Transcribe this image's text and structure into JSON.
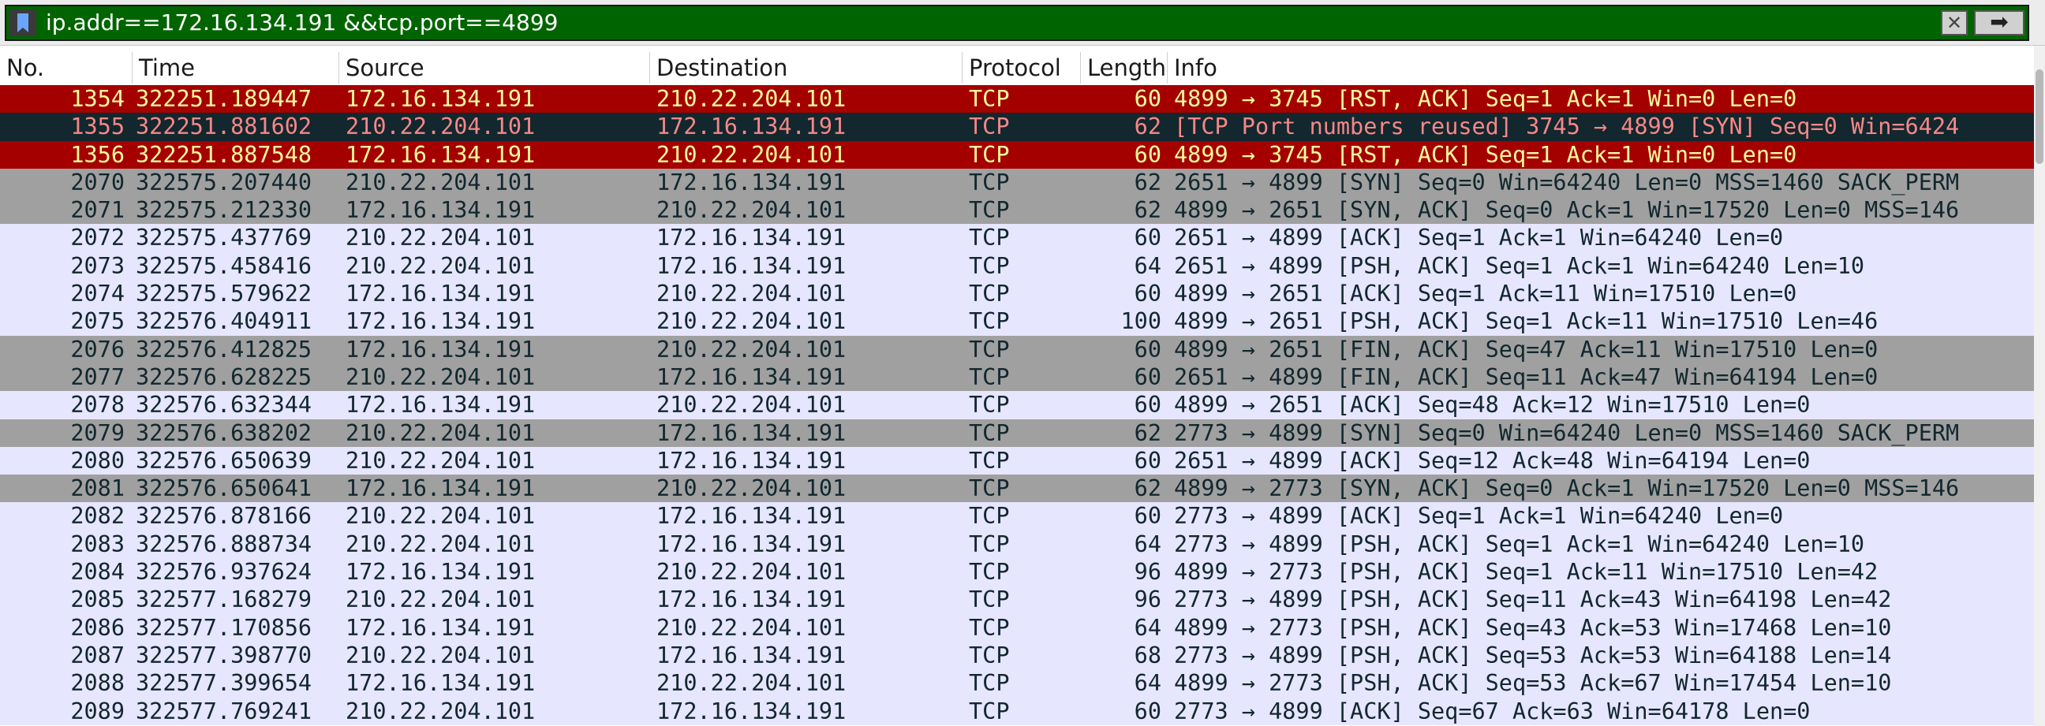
{
  "filter": {
    "value": "ip.addr==172.16.134.191 &&tcp.port==4899"
  },
  "toolbar": {
    "clear_glyph": "✕",
    "apply_glyph": "➡"
  },
  "columns": {
    "no": "No.",
    "time": "Time",
    "source": "Source",
    "destination": "Destination",
    "protocol": "Protocol",
    "length": "Length",
    "info": "Info"
  },
  "colors": {
    "rst_bg": "#a40000",
    "rst_fg": "#fffc9c",
    "reused_bg": "#12272e",
    "reused_fg": "#f78787",
    "syn_fin_bg": "#a0a0a0",
    "syn_fin_fg": "#12272e",
    "tcp_bg": "#e7e6ff",
    "tcp_fg": "#12272e",
    "filter_bg": "#006400"
  },
  "packets": [
    {
      "no": "1354",
      "time": "322251.189447",
      "source": "172.16.134.191",
      "destination": "210.22.204.101",
      "protocol": "TCP",
      "length": "60",
      "info": "4899 → 3745 [RST, ACK] Seq=1 Ack=1 Win=0 Len=0",
      "style": "rst"
    },
    {
      "no": "1355",
      "time": "322251.881602",
      "source": "210.22.204.101",
      "destination": "172.16.134.191",
      "protocol": "TCP",
      "length": "62",
      "info": "[TCP Port numbers reused] 3745 → 4899 [SYN] Seq=0 Win=6424",
      "style": "reused"
    },
    {
      "no": "1356",
      "time": "322251.887548",
      "source": "172.16.134.191",
      "destination": "210.22.204.101",
      "protocol": "TCP",
      "length": "60",
      "info": "4899 → 3745 [RST, ACK] Seq=1 Ack=1 Win=0 Len=0",
      "style": "rst"
    },
    {
      "no": "2070",
      "time": "322575.207440",
      "source": "210.22.204.101",
      "destination": "172.16.134.191",
      "protocol": "TCP",
      "length": "62",
      "info": "2651 → 4899 [SYN] Seq=0 Win=64240 Len=0 MSS=1460 SACK_PERM",
      "style": "synfin"
    },
    {
      "no": "2071",
      "time": "322575.212330",
      "source": "172.16.134.191",
      "destination": "210.22.204.101",
      "protocol": "TCP",
      "length": "62",
      "info": "4899 → 2651 [SYN, ACK] Seq=0 Ack=1 Win=17520 Len=0 MSS=146",
      "style": "synfin"
    },
    {
      "no": "2072",
      "time": "322575.437769",
      "source": "210.22.204.101",
      "destination": "172.16.134.191",
      "protocol": "TCP",
      "length": "60",
      "info": "2651 → 4899 [ACK] Seq=1 Ack=1 Win=64240 Len=0",
      "style": "tcp"
    },
    {
      "no": "2073",
      "time": "322575.458416",
      "source": "210.22.204.101",
      "destination": "172.16.134.191",
      "protocol": "TCP",
      "length": "64",
      "info": "2651 → 4899 [PSH, ACK] Seq=1 Ack=1 Win=64240 Len=10",
      "style": "tcp"
    },
    {
      "no": "2074",
      "time": "322575.579622",
      "source": "172.16.134.191",
      "destination": "210.22.204.101",
      "protocol": "TCP",
      "length": "60",
      "info": "4899 → 2651 [ACK] Seq=1 Ack=11 Win=17510 Len=0",
      "style": "tcp"
    },
    {
      "no": "2075",
      "time": "322576.404911",
      "source": "172.16.134.191",
      "destination": "210.22.204.101",
      "protocol": "TCP",
      "length": "100",
      "info": "4899 → 2651 [PSH, ACK] Seq=1 Ack=11 Win=17510 Len=46",
      "style": "tcp"
    },
    {
      "no": "2076",
      "time": "322576.412825",
      "source": "172.16.134.191",
      "destination": "210.22.204.101",
      "protocol": "TCP",
      "length": "60",
      "info": "4899 → 2651 [FIN, ACK] Seq=47 Ack=11 Win=17510 Len=0",
      "style": "synfin"
    },
    {
      "no": "2077",
      "time": "322576.628225",
      "source": "210.22.204.101",
      "destination": "172.16.134.191",
      "protocol": "TCP",
      "length": "60",
      "info": "2651 → 4899 [FIN, ACK] Seq=11 Ack=47 Win=64194 Len=0",
      "style": "synfin"
    },
    {
      "no": "2078",
      "time": "322576.632344",
      "source": "172.16.134.191",
      "destination": "210.22.204.101",
      "protocol": "TCP",
      "length": "60",
      "info": "4899 → 2651 [ACK] Seq=48 Ack=12 Win=17510 Len=0",
      "style": "tcp"
    },
    {
      "no": "2079",
      "time": "322576.638202",
      "source": "210.22.204.101",
      "destination": "172.16.134.191",
      "protocol": "TCP",
      "length": "62",
      "info": "2773 → 4899 [SYN] Seq=0 Win=64240 Len=0 MSS=1460 SACK_PERM",
      "style": "synfin"
    },
    {
      "no": "2080",
      "time": "322576.650639",
      "source": "210.22.204.101",
      "destination": "172.16.134.191",
      "protocol": "TCP",
      "length": "60",
      "info": "2651 → 4899 [ACK] Seq=12 Ack=48 Win=64194 Len=0",
      "style": "tcp"
    },
    {
      "no": "2081",
      "time": "322576.650641",
      "source": "172.16.134.191",
      "destination": "210.22.204.101",
      "protocol": "TCP",
      "length": "62",
      "info": "4899 → 2773 [SYN, ACK] Seq=0 Ack=1 Win=17520 Len=0 MSS=146",
      "style": "synfin"
    },
    {
      "no": "2082",
      "time": "322576.878166",
      "source": "210.22.204.101",
      "destination": "172.16.134.191",
      "protocol": "TCP",
      "length": "60",
      "info": "2773 → 4899 [ACK] Seq=1 Ack=1 Win=64240 Len=0",
      "style": "tcp"
    },
    {
      "no": "2083",
      "time": "322576.888734",
      "source": "210.22.204.101",
      "destination": "172.16.134.191",
      "protocol": "TCP",
      "length": "64",
      "info": "2773 → 4899 [PSH, ACK] Seq=1 Ack=1 Win=64240 Len=10",
      "style": "tcp"
    },
    {
      "no": "2084",
      "time": "322576.937624",
      "source": "172.16.134.191",
      "destination": "210.22.204.101",
      "protocol": "TCP",
      "length": "96",
      "info": "4899 → 2773 [PSH, ACK] Seq=1 Ack=11 Win=17510 Len=42",
      "style": "tcp"
    },
    {
      "no": "2085",
      "time": "322577.168279",
      "source": "210.22.204.101",
      "destination": "172.16.134.191",
      "protocol": "TCP",
      "length": "96",
      "info": "2773 → 4899 [PSH, ACK] Seq=11 Ack=43 Win=64198 Len=42",
      "style": "tcp"
    },
    {
      "no": "2086",
      "time": "322577.170856",
      "source": "172.16.134.191",
      "destination": "210.22.204.101",
      "protocol": "TCP",
      "length": "64",
      "info": "4899 → 2773 [PSH, ACK] Seq=43 Ack=53 Win=17468 Len=10",
      "style": "tcp"
    },
    {
      "no": "2087",
      "time": "322577.398770",
      "source": "210.22.204.101",
      "destination": "172.16.134.191",
      "protocol": "TCP",
      "length": "68",
      "info": "2773 → 4899 [PSH, ACK] Seq=53 Ack=53 Win=64188 Len=14",
      "style": "tcp"
    },
    {
      "no": "2088",
      "time": "322577.399654",
      "source": "172.16.134.191",
      "destination": "210.22.204.101",
      "protocol": "TCP",
      "length": "64",
      "info": "4899 → 2773 [PSH, ACK] Seq=53 Ack=67 Win=17454 Len=10",
      "style": "tcp"
    },
    {
      "no": "2089",
      "time": "322577.769241",
      "source": "210.22.204.101",
      "destination": "172.16.134.191",
      "protocol": "TCP",
      "length": "60",
      "info": "2773 → 4899 [ACK] Seq=67 Ack=63 Win=64178 Len=0",
      "style": "tcp"
    }
  ]
}
